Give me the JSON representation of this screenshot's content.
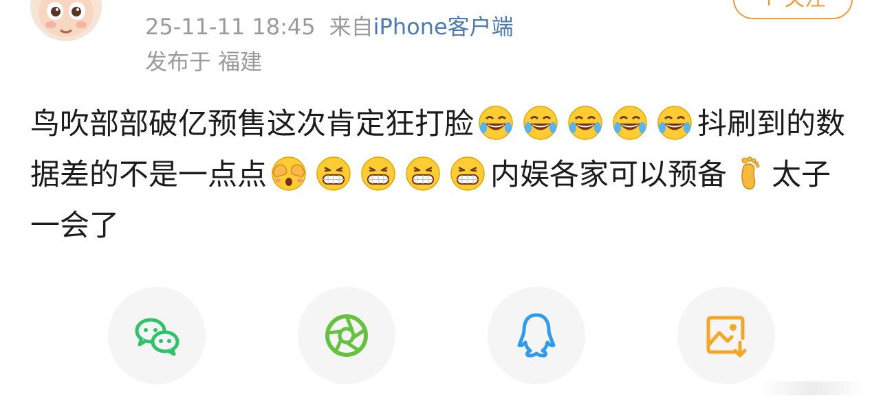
{
  "post": {
    "meta": {
      "time": "25-11-11 18:45",
      "via_prefix": "来自",
      "client": "iPhone客户端",
      "location": "发布于 福建"
    },
    "follow_label": "+ 关注",
    "body": {
      "segment_1": "鸟吹部部破亿预售这次肯定狂打脸",
      "segment_2": "抖刷到的数据差的不是一点点",
      "segment_3": "内娱各家可以预备",
      "segment_4": "太子一会了"
    },
    "emoticons": {
      "laugh_cry": "laugh-cry-emoji",
      "cover_eyes": "cover-eyes-emoji",
      "grin": "grin-emoji",
      "foot": "foot-emoji"
    }
  },
  "share_bar": [
    {
      "icon": "wechat-icon",
      "color": "#2ec26a"
    },
    {
      "icon": "moments-icon",
      "color": "#64c23e"
    },
    {
      "icon": "qq-icon",
      "color": "#2d9cf0"
    },
    {
      "icon": "save-image-icon",
      "color": "#f5a623"
    }
  ],
  "colors": {
    "meta_text": "#9a9a9a",
    "client_link": "#4a7bb5",
    "accent": "#f29a38",
    "body_text": "#1b1b1b"
  }
}
